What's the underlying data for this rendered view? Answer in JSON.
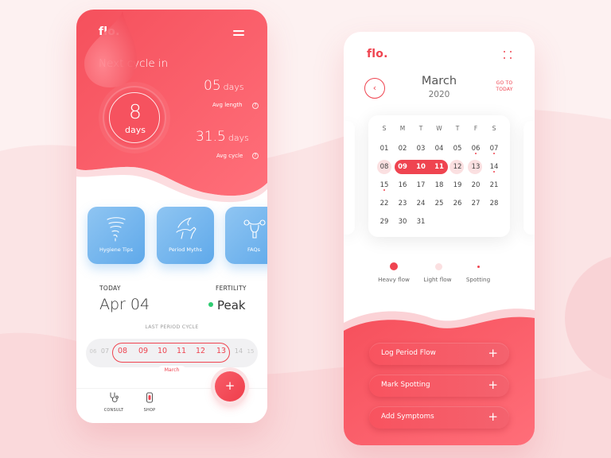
{
  "brand": {
    "logo": "flo.",
    "accent": "#ef4450",
    "card_blue": "#6aaeea",
    "fertility_green": "#2ecc71"
  },
  "home": {
    "next_cycle_title": "Next cycle in",
    "countdown": {
      "value": "8",
      "unit": "days"
    },
    "avg_length": {
      "value": "05",
      "unit": "days",
      "label": "Avg length"
    },
    "avg_cycle": {
      "value": "31.5",
      "unit": "days",
      "label": "Avg cycle"
    },
    "help_glyph": "?",
    "cards": [
      {
        "label": "Hygiene Tips",
        "icon": "tornado-icon"
      },
      {
        "label": "Period Myths",
        "icon": "pegasus-icon"
      },
      {
        "label": "FAQs",
        "icon": "uterus-icon"
      }
    ],
    "today_label": "TODAY",
    "today_date": "Apr 04",
    "fertility_label": "FERTILITY",
    "fertility_value": "Peak",
    "last_period_label": "LAST PERIOD CYCLE",
    "cycle_days_before": [
      "06",
      "07"
    ],
    "cycle_days_period": [
      "08",
      "09",
      "10",
      "11",
      "12",
      "13"
    ],
    "cycle_days_after": [
      "14",
      "15"
    ],
    "cycle_month": "March",
    "tabs": [
      {
        "label": "CONSULT",
        "icon": "stethoscope-icon"
      },
      {
        "label": "SHOP",
        "icon": "pad-icon"
      }
    ],
    "fab_glyph": "+"
  },
  "calendar": {
    "back_glyph": "‹",
    "month": "March",
    "year": "2020",
    "go_to_today": "GO TO TODAY",
    "weekdays": [
      "S",
      "M",
      "T",
      "W",
      "T",
      "F",
      "S"
    ],
    "weeks": [
      [
        "01",
        "02",
        "03",
        "04",
        "05",
        "06",
        "07"
      ],
      [
        "08",
        "09",
        "10",
        "11",
        "12",
        "13",
        "14"
      ],
      [
        "15",
        "16",
        "17",
        "18",
        "19",
        "20",
        "21"
      ],
      [
        "22",
        "23",
        "24",
        "25",
        "26",
        "27",
        "28"
      ],
      [
        "29",
        "30",
        "31",
        "",
        "",
        "",
        ""
      ]
    ],
    "heavy_flow_days": [
      "09",
      "10",
      "11"
    ],
    "light_flow_days": [
      "08",
      "12",
      "13"
    ],
    "spotting_days": [
      "06",
      "07",
      "14",
      "15"
    ],
    "legend": [
      {
        "label": "Heavy flow",
        "color": "#ef4450"
      },
      {
        "label": "Light flow",
        "color": "#fbe0e1"
      },
      {
        "label": "Spotting",
        "color": "#ef4450"
      }
    ],
    "actions": [
      {
        "label": "Log Period Flow",
        "glyph": "+"
      },
      {
        "label": "Mark Spotting",
        "glyph": "+"
      },
      {
        "label": "Add Symptoms",
        "glyph": "+"
      }
    ]
  }
}
